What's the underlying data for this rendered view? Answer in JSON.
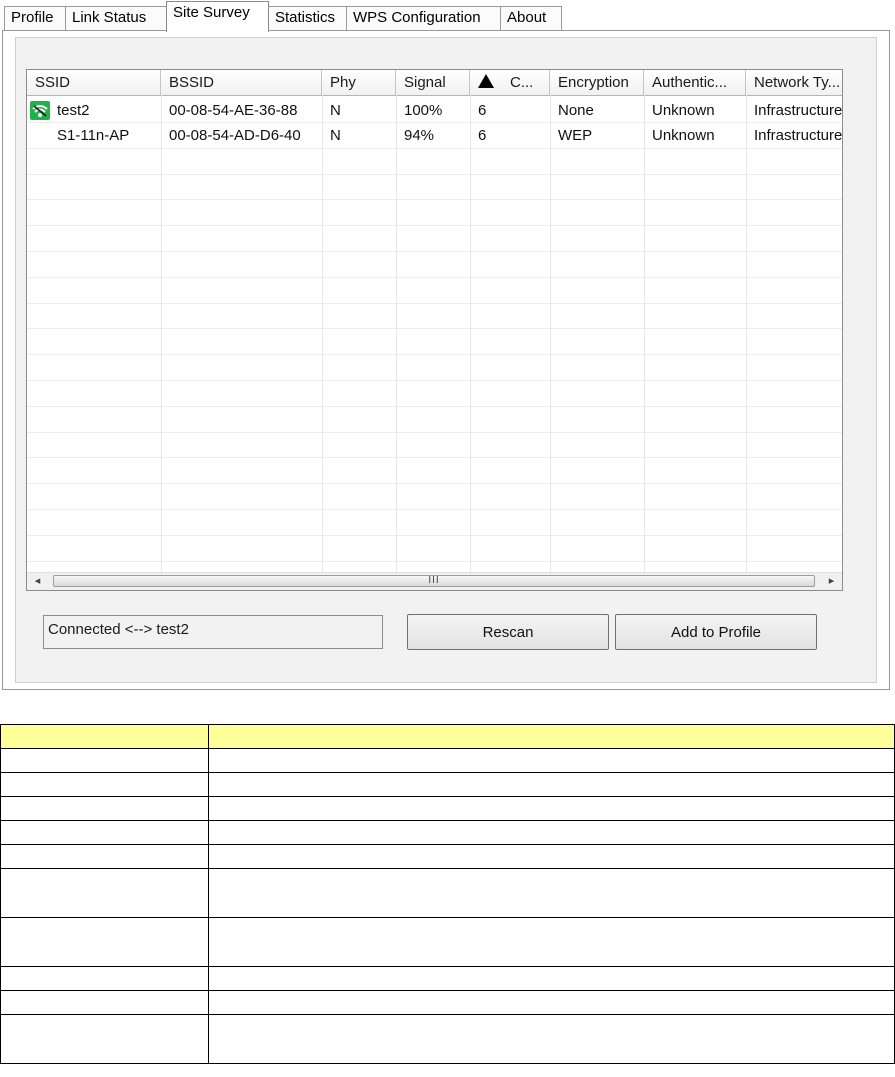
{
  "tabs": [
    {
      "label": "Profile",
      "active": false
    },
    {
      "label": "Link Status",
      "active": false
    },
    {
      "label": "Site Survey",
      "active": true
    },
    {
      "label": "Statistics",
      "active": false
    },
    {
      "label": "WPS Configuration",
      "active": false
    },
    {
      "label": "About",
      "active": false
    }
  ],
  "site_survey": {
    "columns": [
      "SSID",
      "BSSID",
      "Phy",
      "Signal",
      "C...",
      "Encryption",
      "Authentic...",
      "Network Ty..."
    ],
    "rows": [
      {
        "connected": true,
        "ssid": "test2",
        "bssid": "00-08-54-AE-36-88",
        "phy": "N",
        "signal": "100%",
        "channel": "6",
        "encryption": "None",
        "auth": "Unknown",
        "network_type": "Infrastructure"
      },
      {
        "connected": false,
        "ssid": "S1-11n-AP",
        "bssid": "00-08-54-AD-D6-40",
        "phy": "N",
        "signal": "94%",
        "channel": "6",
        "encryption": "WEP",
        "auth": "Unknown",
        "network_type": "Infrastructure"
      }
    ],
    "scroll_left_glyph": "◂",
    "scroll_right_glyph": "▸",
    "scroll_thumb_grip": "III",
    "status_text": "Connected <--> test2",
    "rescan_label": "Rescan",
    "add_profile_label": "Add to Profile"
  },
  "colors": {
    "connected_icon": "#22b14c",
    "table_header": "#ffff99"
  }
}
